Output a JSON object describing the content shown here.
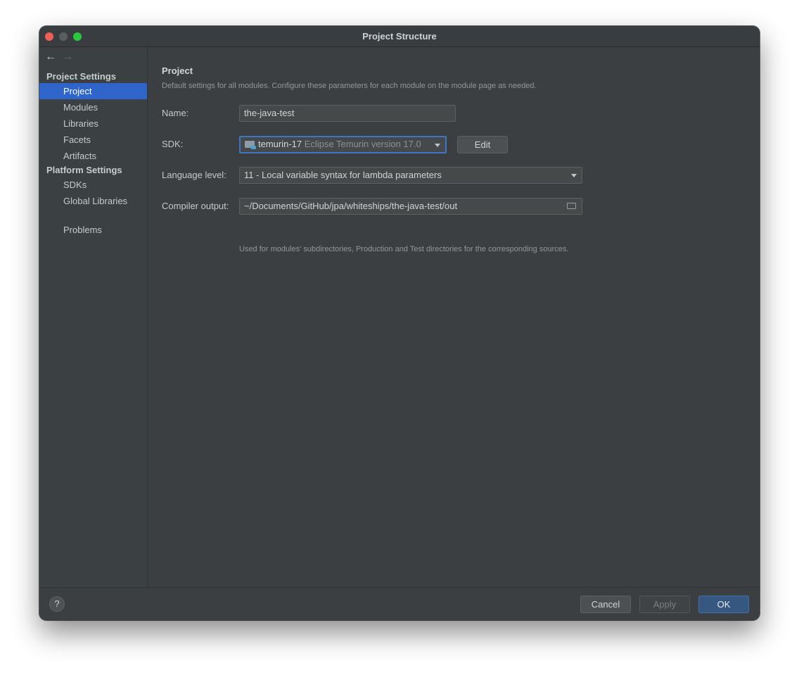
{
  "window": {
    "title": "Project Structure"
  },
  "sidebar": {
    "sections": [
      {
        "header": "Project Settings",
        "items": [
          "Project",
          "Modules",
          "Libraries",
          "Facets",
          "Artifacts"
        ]
      },
      {
        "header": "Platform Settings",
        "items": [
          "SDKs",
          "Global Libraries"
        ]
      }
    ],
    "extra_item": "Problems",
    "selected": "Project"
  },
  "main": {
    "title": "Project",
    "description": "Default settings for all modules. Configure these parameters for each module on the module page as needed.",
    "name": {
      "label": "Name:",
      "value": "the-java-test"
    },
    "sdk": {
      "label": "SDK:",
      "name": "temurin-17",
      "version": "Eclipse Temurin version 17.0",
      "edit_label": "Edit"
    },
    "language_level": {
      "label": "Language level:",
      "value": "11 - Local variable syntax for lambda parameters"
    },
    "compiler_output": {
      "label": "Compiler output:",
      "value": "~/Documents/GitHub/jpa/whiteships/the-java-test/out",
      "hint": "Used for modules' subdirectories, Production and Test directories for the corresponding sources."
    }
  },
  "footer": {
    "help": "?",
    "cancel": "Cancel",
    "apply": "Apply",
    "ok": "OK"
  }
}
